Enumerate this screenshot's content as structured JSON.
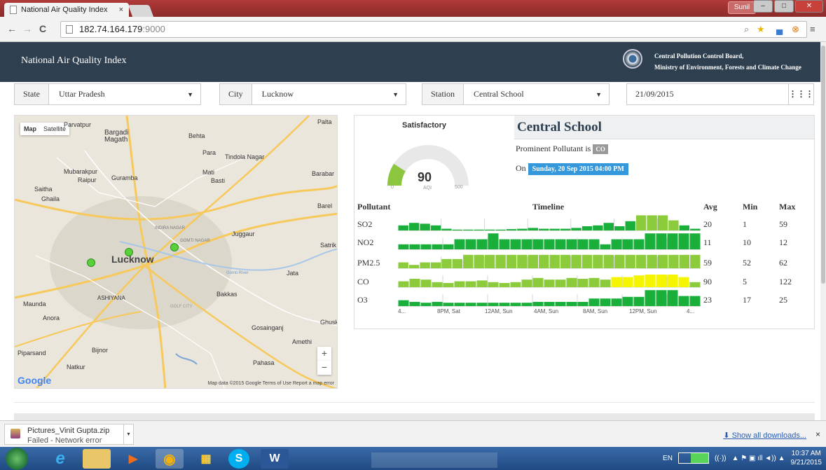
{
  "browser": {
    "tab_title": "National Air Quality Index",
    "tab_close": "×",
    "user": "Sunil",
    "url_host": "182.74.164.179",
    "url_port": ":9000"
  },
  "header": {
    "title": "National Air Quality Index",
    "org_line1": "Central Pollution Control Board,",
    "org_line2": "Ministry of Environment, Forests and Climate Change"
  },
  "filters": {
    "state_label": "State",
    "state_value": "Uttar Pradesh",
    "city_label": "City",
    "city_value": "Lucknow",
    "station_label": "Station",
    "station_value": "Central School",
    "date_value": "21/09/2015"
  },
  "map": {
    "toggle_map": "Map",
    "toggle_satellite": "Satellite",
    "city_label": "Lucknow",
    "places": [
      "Parvatpur",
      "Bargadi Magath",
      "Behta",
      "Palta",
      "Para",
      "Tindola Nagar",
      "Mubarakpur",
      "Raipur",
      "Guramba",
      "Mati",
      "Basti",
      "Barabar",
      "Saitha",
      "Ghaila",
      "Juggaur",
      "Satrik",
      "Jata",
      "Maunda",
      "Anora",
      "ASHIYANA",
      "Bakkas",
      "Gosainganj",
      "Ghusk",
      "Amethi",
      "Piparsand",
      "Bijnor",
      "Natkur",
      "Pahasa",
      "Barel",
      "INDIRA NAGAR",
      "GOMTI NAGAR",
      "GOLF CITY",
      "Gomti River"
    ],
    "attribution": "Map data ©2015 Google   Terms of Use   Report a map error",
    "google": "Google",
    "zoom_in": "+",
    "zoom_out": "−",
    "markers": 3
  },
  "station": {
    "name": "Central School",
    "status": "Satisfactory",
    "aqi": "90",
    "aqi_label": "AQI",
    "gauge_min": "0",
    "gauge_max": "500",
    "aqi_fraction": 0.18,
    "prominent_text": "Prominent Pollutant is",
    "prominent": "CO",
    "on_text": "On",
    "timestamp": "Sunday, 20 Sep 2015 04:00 PM"
  },
  "table": {
    "headers": {
      "pollutant": "Pollutant",
      "timeline": "Timeline",
      "avg": "Avg",
      "min": "Min",
      "max": "Max"
    },
    "rows": [
      {
        "name": "SO2",
        "avg": "20",
        "min": "1",
        "max": "59"
      },
      {
        "name": "NO2",
        "avg": "11",
        "min": "10",
        "max": "12"
      },
      {
        "name": "PM2.5",
        "avg": "59",
        "min": "52",
        "max": "62"
      },
      {
        "name": "CO",
        "avg": "90",
        "min": "5",
        "max": "122"
      },
      {
        "name": "O3",
        "avg": "23",
        "min": "17",
        "max": "25"
      }
    ],
    "axis": [
      "4...",
      "8PM, Sat",
      "12AM, Sun",
      "4AM, Sun",
      "8AM, Sun",
      "12PM, Sun",
      "4..."
    ]
  },
  "timeline": {
    "colors": {
      "good": "#1aaf3a",
      "satisfactory": "#8ccc3c",
      "moderate": "#f5f500"
    },
    "series": [
      [
        0.3,
        "good",
        0.45,
        "good",
        0.4,
        "good",
        0.3,
        "good",
        0.1,
        "good",
        0.05,
        "good",
        0.05,
        "good",
        0.05,
        "good",
        0.05,
        "good",
        0.05,
        "good",
        0.08,
        "good",
        0.1,
        "good",
        0.15,
        "good",
        0.1,
        "good",
        0.1,
        "good",
        0.1,
        "good",
        0.15,
        "good",
        0.25,
        "good",
        0.3,
        "good",
        0.45,
        "good",
        0.25,
        "good",
        0.55,
        "good",
        0.9,
        "satisfactory",
        0.9,
        "satisfactory",
        0.9,
        "satisfactory",
        0.6,
        "satisfactory",
        0.3,
        "good",
        0.1,
        "good"
      ],
      [
        0.3,
        "good",
        0.3,
        "good",
        0.3,
        "good",
        0.3,
        "good",
        0.3,
        "good",
        0.6,
        "good",
        0.6,
        "good",
        0.6,
        "good",
        0.95,
        "good",
        0.6,
        "good",
        0.6,
        "good",
        0.6,
        "good",
        0.6,
        "good",
        0.6,
        "good",
        0.6,
        "good",
        0.6,
        "good",
        0.6,
        "good",
        0.6,
        "good",
        0.3,
        "good",
        0.6,
        "good",
        0.6,
        "good",
        0.6,
        "good",
        0.95,
        "good",
        0.95,
        "good",
        0.95,
        "good",
        0.95,
        "good",
        0.95,
        "good"
      ],
      [
        0.35,
        "satisfactory",
        0.2,
        "satisfactory",
        0.35,
        "satisfactory",
        0.35,
        "satisfactory",
        0.55,
        "satisfactory",
        0.55,
        "satisfactory",
        0.8,
        "satisfactory",
        0.8,
        "satisfactory",
        0.8,
        "satisfactory",
        0.8,
        "satisfactory",
        0.8,
        "satisfactory",
        0.8,
        "satisfactory",
        0.8,
        "satisfactory",
        0.8,
        "satisfactory",
        0.8,
        "satisfactory",
        0.8,
        "satisfactory",
        0.8,
        "satisfactory",
        0.8,
        "satisfactory",
        0.8,
        "satisfactory",
        0.8,
        "satisfactory",
        0.8,
        "satisfactory",
        0.8,
        "satisfactory",
        0.8,
        "satisfactory",
        0.8,
        "satisfactory",
        0.8,
        "satisfactory",
        0.8,
        "satisfactory",
        0.8,
        "satisfactory",
        0.8,
        "satisfactory"
      ],
      [
        0.35,
        "satisfactory",
        0.5,
        "satisfactory",
        0.45,
        "satisfactory",
        0.3,
        "satisfactory",
        0.25,
        "satisfactory",
        0.35,
        "satisfactory",
        0.35,
        "satisfactory",
        0.4,
        "satisfactory",
        0.3,
        "satisfactory",
        0.25,
        "satisfactory",
        0.3,
        "satisfactory",
        0.45,
        "satisfactory",
        0.55,
        "satisfactory",
        0.45,
        "satisfactory",
        0.45,
        "satisfactory",
        0.55,
        "satisfactory",
        0.5,
        "satisfactory",
        0.55,
        "satisfactory",
        0.45,
        "satisfactory",
        0.6,
        "moderate",
        0.6,
        "moderate",
        0.7,
        "moderate",
        0.75,
        "moderate",
        0.75,
        "moderate",
        0.75,
        "moderate",
        0.6,
        "moderate",
        0.3,
        "satisfactory"
      ],
      [
        0.35,
        "good",
        0.25,
        "good",
        0.2,
        "good",
        0.25,
        "good",
        0.2,
        "good",
        0.2,
        "good",
        0.2,
        "good",
        0.2,
        "good",
        0.2,
        "good",
        0.2,
        "good",
        0.2,
        "good",
        0.2,
        "good",
        0.25,
        "good",
        0.25,
        "good",
        0.25,
        "good",
        0.25,
        "good",
        0.25,
        "good",
        0.45,
        "good",
        0.45,
        "good",
        0.45,
        "good",
        0.55,
        "good",
        0.55,
        "good",
        0.95,
        "good",
        0.95,
        "good",
        0.95,
        "good",
        0.6,
        "good",
        0.6,
        "good"
      ]
    ]
  },
  "download": {
    "file": "Pictures_Vinit Gupta.zip",
    "status": "Failed - Network error",
    "show_all": "Show all downloads...",
    "close": "×"
  },
  "taskbar": {
    "lang": "EN",
    "time": "10:37 AM",
    "date": "9/21/2015"
  }
}
